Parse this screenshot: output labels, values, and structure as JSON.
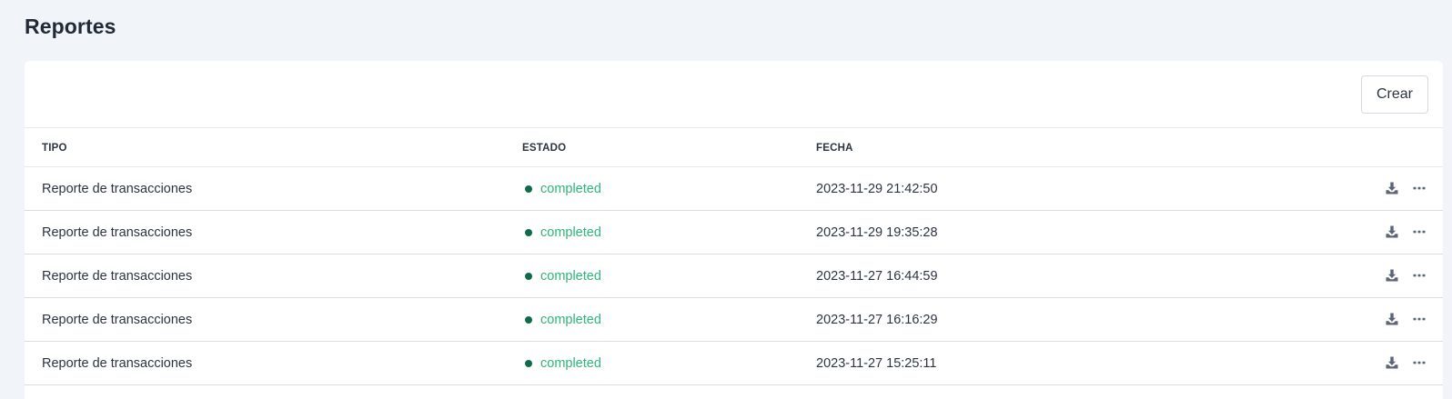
{
  "page": {
    "title": "Reportes"
  },
  "toolbar": {
    "create_label": "Crear"
  },
  "table": {
    "headers": {
      "tipo": "TIPO",
      "estado": "ESTADO",
      "fecha": "FECHA"
    },
    "rows": [
      {
        "tipo": "Reporte de transacciones",
        "estado": "completed",
        "fecha": "2023-11-29 21:42:50"
      },
      {
        "tipo": "Reporte de transacciones",
        "estado": "completed",
        "fecha": "2023-11-29 19:35:28"
      },
      {
        "tipo": "Reporte de transacciones",
        "estado": "completed",
        "fecha": "2023-11-27 16:44:59"
      },
      {
        "tipo": "Reporte de transacciones",
        "estado": "completed",
        "fecha": "2023-11-27 16:16:29"
      },
      {
        "tipo": "Reporte de transacciones",
        "estado": "completed",
        "fecha": "2023-11-27 15:25:11"
      }
    ],
    "row_actions": {
      "download_icon": "download-icon",
      "more_icon": "more-horizontal-icon"
    }
  },
  "colors": {
    "status_completed_text": "#2fb57a",
    "status_completed_dot": "#0e6b45",
    "icon": "#5c6577"
  }
}
